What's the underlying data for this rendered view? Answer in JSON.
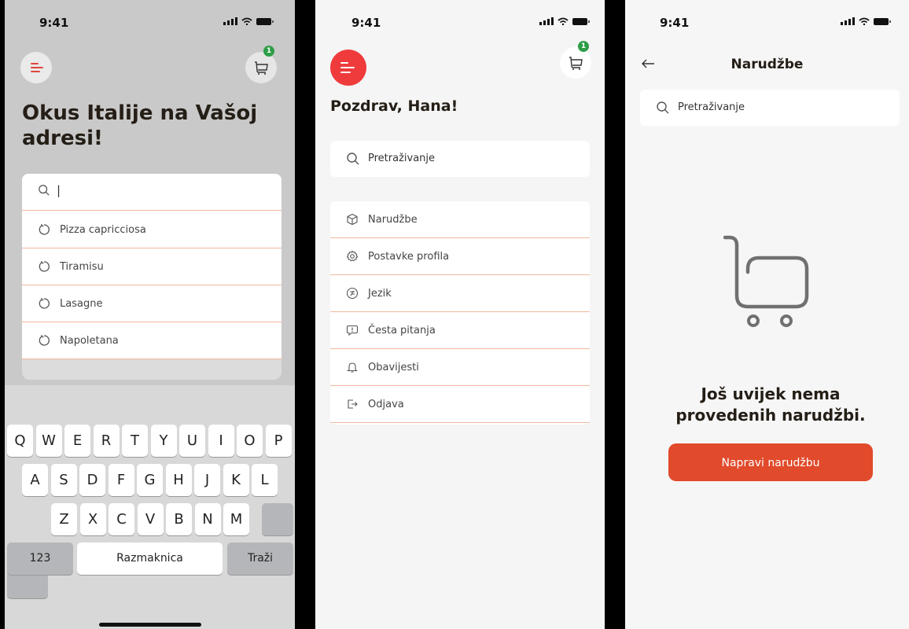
{
  "phone1": {
    "status": {
      "time": "9:41"
    },
    "cart_badge": "1",
    "headline": "Okus Italije na Vašoj adresi!",
    "search": {
      "value": "|"
    },
    "suggestions": [
      "Pizza capricciosa",
      "Tiramisu",
      "Lasagne",
      "Napoletana"
    ],
    "keyboard": {
      "row1": [
        "Q",
        "W",
        "E",
        "R",
        "T",
        "Y",
        "U",
        "I",
        "O",
        "P"
      ],
      "row2": [
        "A",
        "S",
        "D",
        "F",
        "G",
        "H",
        "J",
        "K",
        "L"
      ],
      "row3": [
        "Z",
        "X",
        "C",
        "V",
        "B",
        "N",
        "M"
      ],
      "numbers_key": "123",
      "space_key": "Razmaknica",
      "search_key": "Traži"
    }
  },
  "phone2": {
    "status": {
      "time": "9:41"
    },
    "cart_badge": "1",
    "greeting": "Pozdrav, Hana!",
    "search": {
      "placeholder": "Pretraživanje"
    },
    "menu": [
      {
        "label": "Narudžbe",
        "icon": "box-icon"
      },
      {
        "label": "Postavke profila",
        "icon": "gear-icon"
      },
      {
        "label": "Jezik",
        "icon": "language-icon"
      },
      {
        "label": "Česta pitanja",
        "icon": "faq-icon"
      },
      {
        "label": "Obavijesti",
        "icon": "bell-icon"
      },
      {
        "label": "Odjava",
        "icon": "logout-icon"
      }
    ]
  },
  "phone3": {
    "status": {
      "time": "9:41"
    },
    "title": "Narudžbe",
    "search": {
      "placeholder": "Pretraživanje"
    },
    "empty_message": "Još uvijek nema provedenih narudžbi.",
    "cta_label": "Napravi narudžbu"
  },
  "colors": {
    "accent": "#ef3b3b",
    "cta": "#e14a2b",
    "badge": "#2e9e48",
    "divider": "#f1b79d"
  }
}
